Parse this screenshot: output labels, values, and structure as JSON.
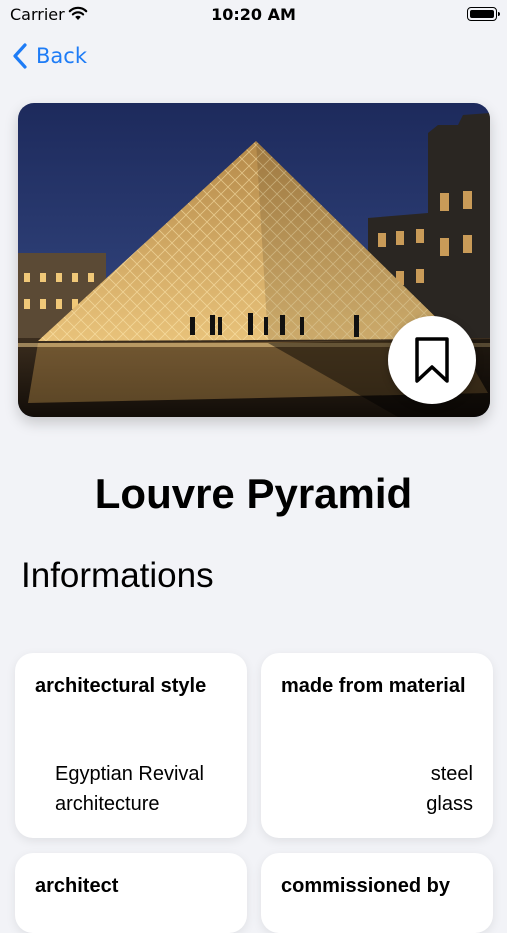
{
  "status_bar": {
    "carrier": "Carrier",
    "time": "10:20 AM",
    "wifi_icon": "wifi-icon",
    "battery_icon": "battery-icon"
  },
  "nav": {
    "back_label": "Back",
    "back_icon": "chevron-left-icon",
    "accent_color": "#1e7cf6"
  },
  "hero": {
    "image_subject": "Louvre Pyramid at dusk",
    "bookmark_icon": "bookmark-icon"
  },
  "title": "Louvre Pyramid",
  "section_title": "Informations",
  "cards": [
    {
      "label": "architectural style",
      "values": [
        "Egyptian Revival",
        "architecture"
      ]
    },
    {
      "label": "made from material",
      "values": [
        "steel",
        "glass"
      ]
    },
    {
      "label": "architect",
      "values": []
    },
    {
      "label": "commissioned by",
      "values": []
    }
  ]
}
